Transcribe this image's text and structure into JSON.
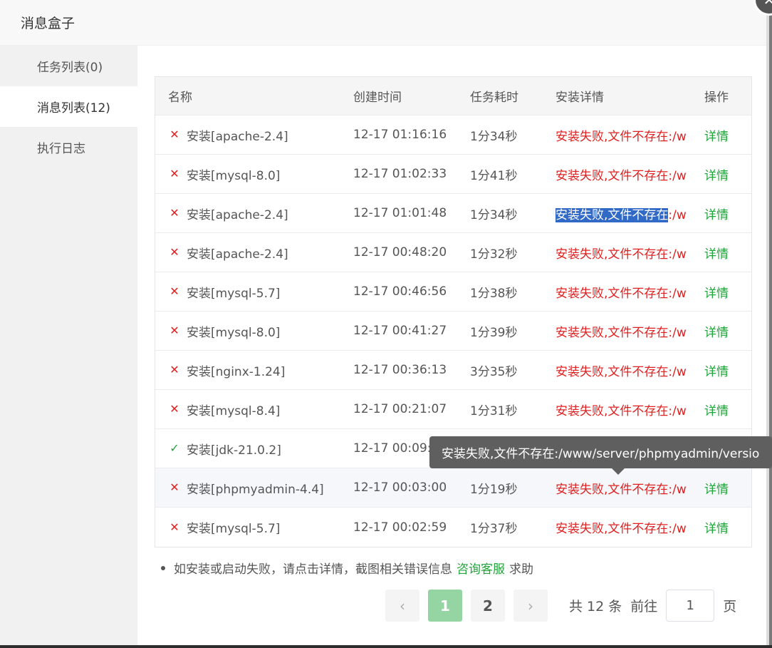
{
  "dialog": {
    "title": "消息盒子"
  },
  "sidebar": {
    "items": [
      {
        "label": "任务列表(0)"
      },
      {
        "label": "消息列表(12)"
      },
      {
        "label": "执行日志"
      }
    ]
  },
  "table": {
    "headers": {
      "name": "名称",
      "created": "创建时间",
      "duration": "任务耗时",
      "details": "安装详情",
      "ops": "操作"
    },
    "rows": [
      {
        "status": "fail",
        "name": "安装[apache-2.4]",
        "created": "12-17 01:16:16",
        "duration": "1分34秒",
        "details": "安装失败,文件不存在:/w",
        "op": "详情"
      },
      {
        "status": "fail",
        "name": "安装[mysql-8.0]",
        "created": "12-17 01:02:33",
        "duration": "1分41秒",
        "details": "安装失败,文件不存在:/w",
        "op": "详情"
      },
      {
        "status": "fail",
        "name": "安装[apache-2.4]",
        "created": "12-17 01:01:48",
        "duration": "1分34秒",
        "details_selected": "安装失败,文件不存在",
        "details_rest": ":/w",
        "op": "详情"
      },
      {
        "status": "fail",
        "name": "安装[apache-2.4]",
        "created": "12-17 00:48:20",
        "duration": "1分32秒",
        "details": "安装失败,文件不存在:/w",
        "op": "详情"
      },
      {
        "status": "fail",
        "name": "安装[mysql-5.7]",
        "created": "12-17 00:46:56",
        "duration": "1分38秒",
        "details": "安装失败,文件不存在:/w",
        "op": "详情"
      },
      {
        "status": "fail",
        "name": "安装[mysql-8.0]",
        "created": "12-17 00:41:27",
        "duration": "1分39秒",
        "details": "安装失败,文件不存在:/w",
        "op": "详情"
      },
      {
        "status": "fail",
        "name": "安装[nginx-1.24]",
        "created": "12-17 00:36:13",
        "duration": "3分35秒",
        "details": "安装失败,文件不存在:/w",
        "op": "详情"
      },
      {
        "status": "fail",
        "name": "安装[mysql-8.4]",
        "created": "12-17 00:21:07",
        "duration": "1分31秒",
        "details": "安装失败,文件不存在:/w",
        "op": "详情"
      },
      {
        "status": "ok",
        "name": "安装[jdk-21.0.2]",
        "created": "12-17 00:09:",
        "duration": "",
        "details": "",
        "op": ""
      },
      {
        "status": "fail",
        "name": "安装[phpmyadmin-4.4]",
        "created": "12-17 00:03:00",
        "duration": "1分19秒",
        "details": "安装失败,文件不存在:/w",
        "op": "详情"
      },
      {
        "status": "fail",
        "name": "安装[mysql-5.7]",
        "created": "12-17 00:02:59",
        "duration": "1分37秒",
        "details": "安装失败,文件不存在:/w",
        "op": "详情"
      }
    ]
  },
  "tooltip": {
    "text": "安装失败,文件不存在:/www/server/phpmyadmin/versio"
  },
  "help": {
    "prefix": "如安装或启动失败，请点击详情，截图相关错误信息",
    "link": "咨询客服",
    "suffix": "求助"
  },
  "pager": {
    "prev": "‹",
    "next": "›",
    "pages": [
      "1",
      "2"
    ],
    "current": "1",
    "total_text": "共 12 条",
    "goto_label": "前往",
    "goto_value": "1",
    "page_unit": "页"
  },
  "icons": {
    "fail": "✕",
    "ok": "✓",
    "close": "✕"
  },
  "colors": {
    "accent": "#20a53a",
    "error": "#e02020",
    "selection": "#3169c6"
  }
}
